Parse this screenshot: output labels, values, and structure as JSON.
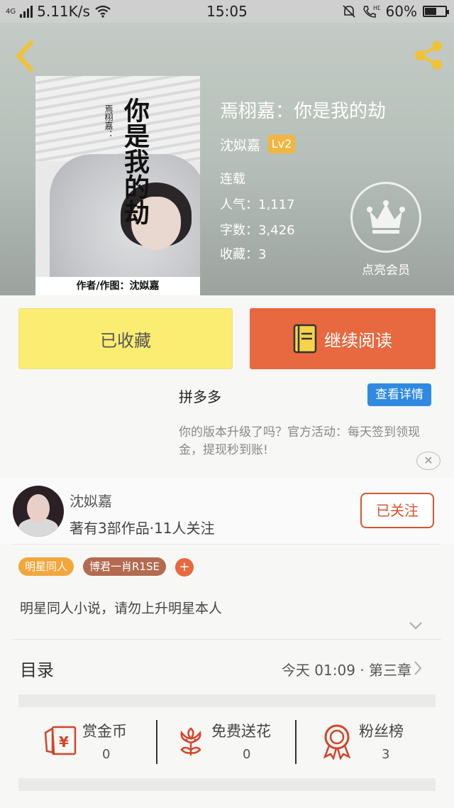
{
  "status_bar": {
    "network": "4G",
    "speed": "5.11K/s",
    "time": "15:05",
    "battery": "60%",
    "battery_level": 0.6
  },
  "book": {
    "title": "焉栩嘉：你是我的劫",
    "author": "沈姒嘉",
    "level": "Lv2",
    "status": "连载",
    "popularity": "人气：1,117",
    "word_count": "字数：3,426",
    "collections": "收藏：3",
    "cover_title": "你是我的劫",
    "cover_author": "焉栩嘉：",
    "cover_credit": "作者/作图：沈姒嘉"
  },
  "vip": {
    "label": "点亮会员"
  },
  "actions": {
    "collected": "已收藏",
    "continue_reading": "继续阅读"
  },
  "ad": {
    "brand": "拼多多",
    "detail_button": "查看详情",
    "text": "你的版本升级了吗？官方活动：每天签到领现金，提现秒到账!",
    "close": "✕"
  },
  "author_section": {
    "name": "沈姒嘉",
    "stats": "著有3部作品·11人关注",
    "follow": "已关注"
  },
  "tags": [
    {
      "label": "明星同人",
      "color": "#f3a63c"
    },
    {
      "label": "博君一肖R1SE",
      "color": "#b36a50"
    }
  ],
  "tag_add": "+",
  "description": "明星同人小说，请勿上升明星本人",
  "toc": {
    "label": "目录",
    "latest": "今天 01:09 · 第三章"
  },
  "features": [
    {
      "label": "赏金币",
      "count": "0",
      "icon": "red-envelope-icon"
    },
    {
      "label": "免费送花",
      "count": "0",
      "icon": "flower-icon"
    },
    {
      "label": "粉丝榜",
      "count": "3",
      "icon": "medal-icon"
    }
  ],
  "colors": {
    "accent_orange": "#e8683f",
    "collected_yellow": "#fbed72",
    "ad_blue": "#2f8ae0",
    "icon_red": "#d5432a",
    "badge_gold": "#f0b640"
  }
}
